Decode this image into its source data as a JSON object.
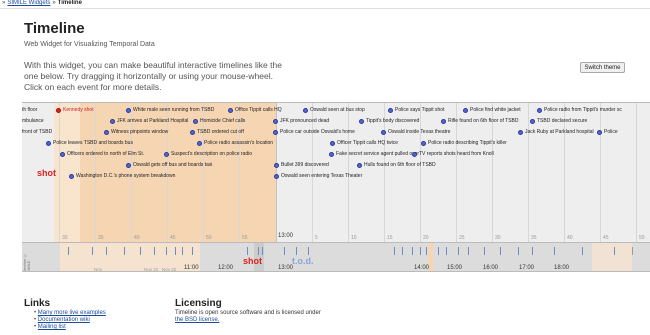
{
  "breadcrumb": {
    "sep": "»",
    "items": [
      "SIMILE Widgets",
      "Timeline"
    ]
  },
  "header": {
    "title": "Timeline",
    "subtitle": "Web Widget for Visualizing Temporal Data"
  },
  "intro": "With this widget, you can make beautiful interactive timelines like the one below. Try dragging it horizontally or using your mouse-wheel. Click on each event for more details.",
  "toolbar": {
    "switch_theme_label": "Switch theme"
  },
  "timeline": {
    "upper_band": {
      "events": [
        {
          "label": "th floor",
          "red": false
        },
        {
          "label": "Kennedy shot",
          "red": true
        },
        {
          "label": "White male seen running from TSBD",
          "red": false
        },
        {
          "label": "Office Tippit calls HQ",
          "red": false
        },
        {
          "label": "Oswald seen at bus stop",
          "red": false
        },
        {
          "label": "Police says Tippit shot",
          "red": false
        },
        {
          "label": "Police find white jacket",
          "red": false
        },
        {
          "label": "Police radio from Tippit's murder sc",
          "red": false
        },
        {
          "label": "mbulance",
          "red": false
        },
        {
          "label": "JFK arrives at Parkland Hospital",
          "red": false
        },
        {
          "label": "Homicide Chief calls",
          "red": false
        },
        {
          "label": "JFK pronounced dead",
          "red": false
        },
        {
          "label": "Tippit's body discovered",
          "red": false
        },
        {
          "label": "Rifle found on 6th floor of TSBD",
          "red": false
        },
        {
          "label": "TSBD declared secure",
          "red": false
        },
        {
          "label": "front of TSBD",
          "red": false
        },
        {
          "label": "Witness pinpoints window",
          "red": false
        },
        {
          "label": "TSBD ordered cut off",
          "red": false
        },
        {
          "label": "Police car outside Oswald's home",
          "red": false
        },
        {
          "label": "Oswald inside Texas theatre",
          "red": false
        },
        {
          "label": "Jack Ruby at Parkland hospital",
          "red": false
        },
        {
          "label": "Police",
          "red": false
        },
        {
          "label": "Police leaves TSBD and boards bus",
          "red": false
        },
        {
          "label": "Police radio assassin's location",
          "red": false
        },
        {
          "label": "Officer Tippit calls HQ twice",
          "red": false
        },
        {
          "label": "Police radio describing Tippit's killer",
          "red": false
        },
        {
          "label": "Officers ordered to north of Elm St.",
          "red": false
        },
        {
          "label": "Suspect's description on police radio",
          "red": false
        },
        {
          "label": "Fake secret service agent pulled over",
          "red": false
        },
        {
          "label": "TV reports shots heard from Knoll",
          "red": false
        },
        {
          "label": "Oswald gets off bus and boards taxi",
          "red": false
        },
        {
          "label": "Bullet 399 discovered",
          "red": false
        },
        {
          "label": "Hulls found on 6th floor of TSBD",
          "red": false
        },
        {
          "label": "Washington D.C.'s phone system breakdown",
          "red": false
        },
        {
          "label": "Oswald seen entering Texas Theater",
          "red": false
        }
      ],
      "tick_numbers": [
        "30",
        "35",
        "40",
        "45",
        "50",
        "55",
        "5",
        "10",
        "15",
        "20",
        "25",
        "30",
        "35",
        "40",
        "45",
        "50",
        "55"
      ],
      "major_label": "13:00",
      "shot_label": "shot"
    },
    "lower_band": {
      "credit": "Timeline © SIMILE",
      "labels": [
        "11:00",
        "12:00",
        "13:00",
        "14:00",
        "15:00",
        "16:00",
        "17:00",
        "18:00"
      ],
      "small_labels": [
        "Nov",
        "Nov 22",
        "Nov 22"
      ],
      "shot_label": "shot",
      "tod_label": "t.o.d."
    }
  },
  "footer": {
    "links": {
      "title": "Links",
      "items": [
        "Many more live examples",
        "Documentation wiki",
        "Mailing list"
      ]
    },
    "licensing": {
      "title": "Licensing",
      "text": "Timeline is open source software and is licensed under",
      "link": "the BSD license."
    }
  },
  "colors": {
    "event_dot": "#5566cc",
    "highlight_event": "#dd2222",
    "shade": "#f6d5b3",
    "band_bg": "#eeeeee"
  }
}
